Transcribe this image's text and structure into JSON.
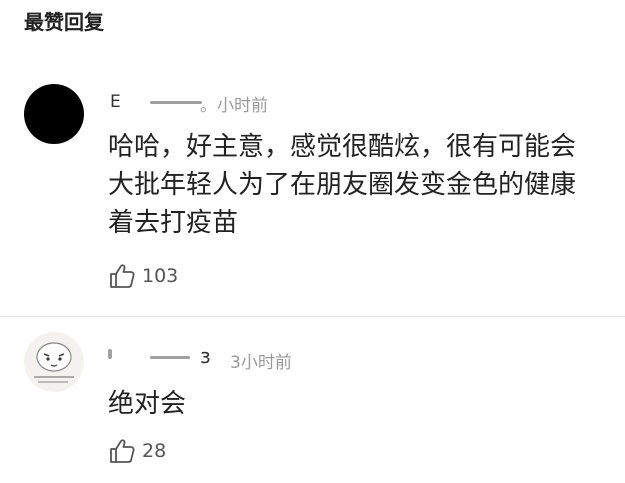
{
  "section": {
    "title": "最赞回复"
  },
  "comments": [
    {
      "username": "Е",
      "time": "。小时前",
      "lines": [
        "哈哈，好主意，感觉很酷炫，很有可能会",
        "大批年轻人为了在朋友圈发变金色的健康",
        "着去打疫苗"
      ],
      "likes": "103"
    },
    {
      "username": "з",
      "time": "3小时前",
      "lines": [
        "绝对会"
      ],
      "likes": "28"
    }
  ]
}
